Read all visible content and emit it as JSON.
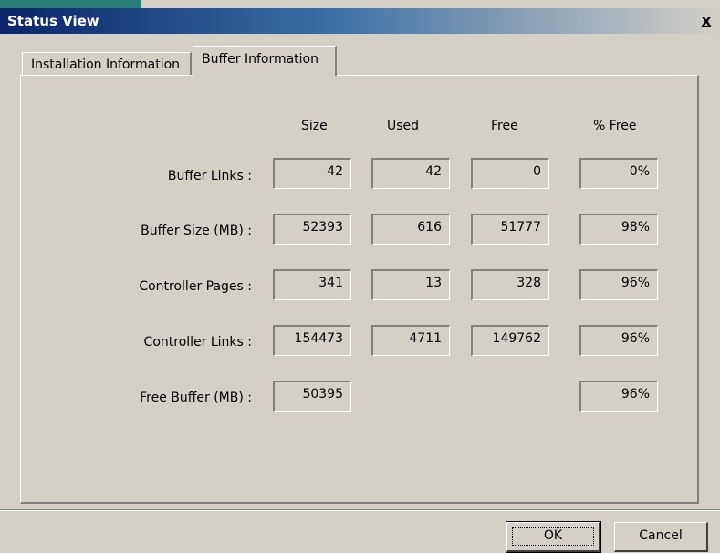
{
  "window": {
    "title": "Status View",
    "close_label": "x"
  },
  "tabs": [
    {
      "label": "Installation Information",
      "active": false
    },
    {
      "label": "Buffer Information",
      "active": true
    }
  ],
  "table": {
    "columns": [
      "Size",
      "Used",
      "Free",
      "% Free"
    ],
    "rows": [
      {
        "label": "Buffer Links :",
        "size": "42",
        "used": "42",
        "free": "0",
        "pct_free": "0%"
      },
      {
        "label": "Buffer Size (MB) :",
        "size": "52393",
        "used": "616",
        "free": "51777",
        "pct_free": "98%"
      },
      {
        "label": "Controller Pages :",
        "size": "341",
        "used": "13",
        "free": "328",
        "pct_free": "96%"
      },
      {
        "label": "Controller Links :",
        "size": "154473",
        "used": "4711",
        "free": "149762",
        "pct_free": "96%"
      },
      {
        "label": "Free Buffer (MB) :",
        "size": "50395",
        "used": null,
        "free": null,
        "pct_free": "96%"
      }
    ]
  },
  "buttons": {
    "ok_label": "OK",
    "cancel_label": "Cancel"
  },
  "colors": {
    "dialog_face": "#d4d0c8",
    "titlebar_start": "#0a246a",
    "titlebar_end": "#d4d0c8",
    "corner_accent": "#2a7f78"
  }
}
